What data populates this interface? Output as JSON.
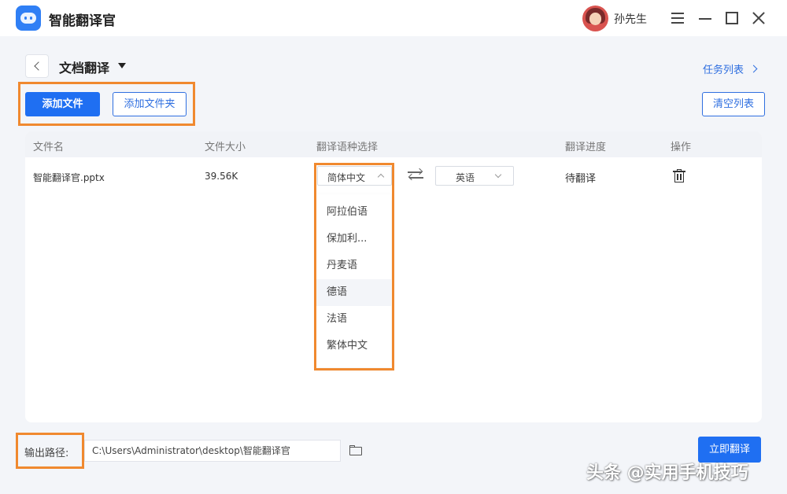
{
  "app": {
    "title": "智能翻译官",
    "user_name": "孙先生"
  },
  "header": {
    "title": "文档翻译",
    "task_list_link": "任务列表"
  },
  "toolbar": {
    "add_file": "添加文件",
    "add_folder": "添加文件夹",
    "clear_list": "清空列表"
  },
  "table": {
    "columns": [
      "文件名",
      "文件大小",
      "翻译语种选择",
      "翻译进度",
      "操作"
    ],
    "rows": [
      {
        "file_name": "智能翻译官.pptx",
        "file_size": "39.56K",
        "source_language": "简体中文",
        "target_language": "英语",
        "progress": "待翻译"
      }
    ]
  },
  "language_dropdown": {
    "options": [
      "阿拉伯语",
      "保加利...",
      "丹麦语",
      "德语",
      "法语",
      "繁体中文"
    ],
    "hovered": "德语"
  },
  "footer": {
    "output_label": "输出路径:",
    "output_path": "C:\\Users\\Administrator\\desktop\\智能翻译官",
    "translate_button": "立即翻译"
  },
  "watermark": "头条 @实用手机技巧",
  "colors": {
    "primary": "#1f6ff2",
    "highlight": "#f0892f",
    "link": "#2f6fe0"
  },
  "icons": [
    "app-logo-icon",
    "back-arrow-icon",
    "dropdown-caret-icon",
    "chevron-right-icon",
    "swap-icon",
    "trash-icon",
    "folder-icon",
    "menu-icon",
    "minimize-icon",
    "maximize-icon",
    "close-icon"
  ]
}
